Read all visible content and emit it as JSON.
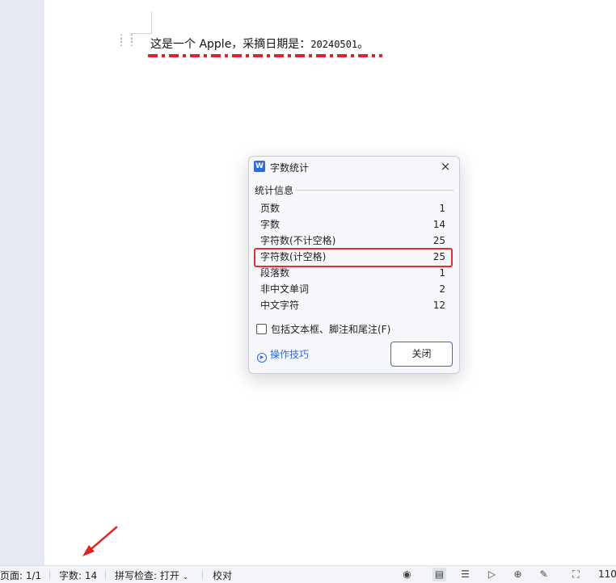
{
  "document": {
    "text_before": "这是一个 Apple，采摘日期是：",
    "text_date": "20240501",
    "text_end": "。"
  },
  "dialog": {
    "logo": "W",
    "title": "字数统计",
    "close_icon": "×",
    "group_label": "统计信息",
    "stats": [
      {
        "label": "页数",
        "value": "1"
      },
      {
        "label": "字数",
        "value": "14"
      },
      {
        "label": "字符数(不计空格)",
        "value": "25"
      },
      {
        "label": "字符数(计空格)",
        "value": "25"
      },
      {
        "label": "段落数",
        "value": "1"
      },
      {
        "label": "非中文单词",
        "value": "2"
      },
      {
        "label": "中文字符",
        "value": "12"
      }
    ],
    "include_label": "包括文本框、脚注和尾注(F)",
    "tips_label": "操作技巧",
    "close_button": "关闭"
  },
  "statusbar": {
    "page": "页面: 1/1",
    "words": "字数: 14",
    "spell": "拼写检查: 打开",
    "proof": "校对",
    "zoom": "110"
  },
  "colors": {
    "accent": "#2f6bd9",
    "highlight": "#e03030",
    "spell_underline": "#d9232e"
  }
}
